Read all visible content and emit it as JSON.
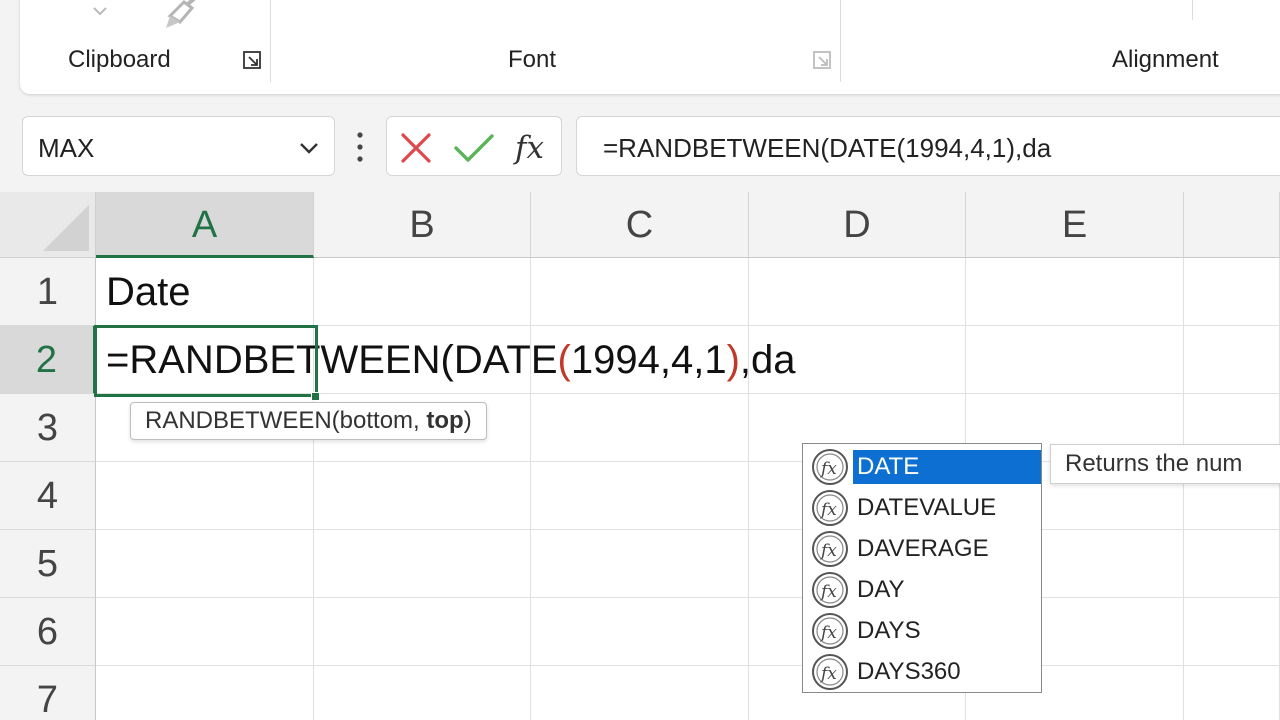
{
  "ribbon": {
    "groups": [
      {
        "label": "Clipboard"
      },
      {
        "label": "Font"
      },
      {
        "label": "Alignment"
      }
    ]
  },
  "formula_bar": {
    "name_box": "MAX",
    "cancel_icon": "close-x-icon",
    "enter_icon": "checkmark-icon",
    "fx_label": "fx",
    "content": "=RANDBETWEEN(DATE(1994,4,1),da"
  },
  "sheet": {
    "columns": [
      "A",
      "B",
      "C",
      "D",
      "E"
    ],
    "rows": [
      "1",
      "2",
      "3",
      "4",
      "5",
      "6",
      "7"
    ],
    "selected_column": "A",
    "selected_row": "2",
    "cells": {
      "A1": "Date",
      "A2_parts": {
        "before": "=RANDBETWEEN(DATE",
        "open_paren": "(",
        "args": "1994,4,1",
        "close_paren": ")",
        "after": ",da"
      }
    }
  },
  "arg_tooltip": {
    "func": "RANDBETWEEN(bottom, ",
    "current_arg": "top",
    "close": ")"
  },
  "autocomplete": {
    "items": [
      "DATE",
      "DATEVALUE",
      "DAVERAGE",
      "DAY",
      "DAYS",
      "DAYS360"
    ],
    "selected": "DATE",
    "description": "Returns the num"
  },
  "colors": {
    "accent_green": "#217346",
    "selection_blue": "#0c6fd1",
    "paren_red": "#c0392b"
  }
}
